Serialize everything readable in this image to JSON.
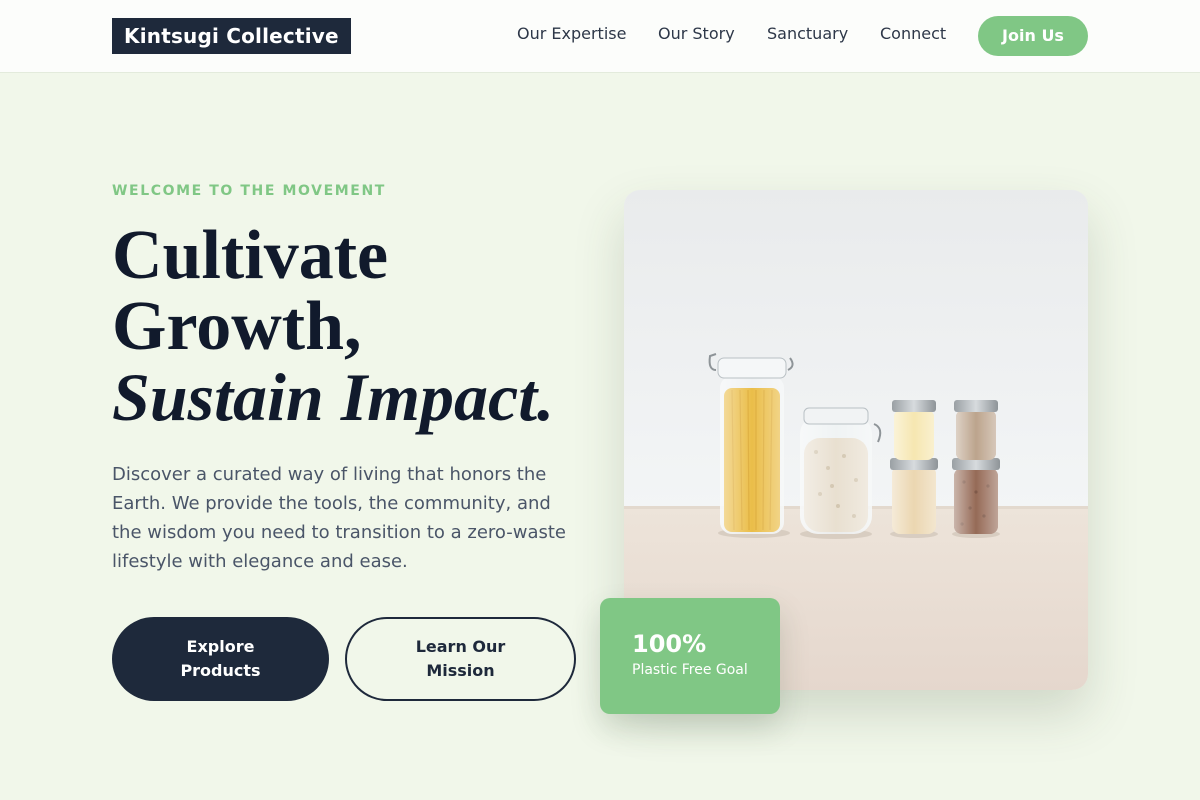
{
  "header": {
    "logo": "Kintsugi Collective",
    "nav": [
      "Our Expertise",
      "Our Story",
      "Sanctuary",
      "Connect"
    ],
    "cta": "Join Us"
  },
  "hero": {
    "eyebrow": "WELCOME TO THE MOVEMENT",
    "headline": {
      "line1": "Cultivate",
      "line2": "Growth,",
      "line3": "Sustain Impact."
    },
    "description": "Discover a curated way of living that honors the Earth. We provide the tools, the community, and the wisdom you need to transition to a zero-waste lifestyle with elegance and ease.",
    "primary_button": "Explore Products",
    "secondary_button": "Learn Our Mission"
  },
  "stat": {
    "value": "100%",
    "label": "Plastic Free Goal"
  },
  "colors": {
    "accent": "#80c785",
    "dark": "#1e293b",
    "background": "#f1f7ea"
  }
}
